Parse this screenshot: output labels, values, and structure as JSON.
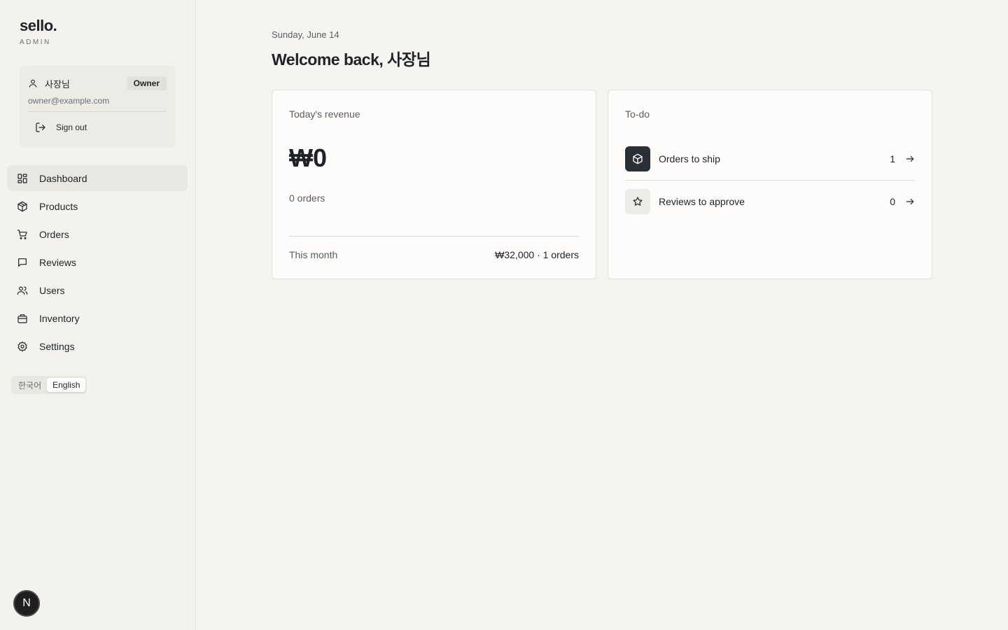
{
  "sidebar": {
    "brand": "sello.",
    "brand_sub": "ADMIN",
    "user": {
      "name": "사장님",
      "role": "Owner",
      "email": "owner@example.com",
      "signout_label": "Sign out"
    },
    "nav": [
      {
        "label": "Dashboard",
        "icon": "dashboard-icon",
        "active": true
      },
      {
        "label": "Products",
        "icon": "box-icon",
        "active": false
      },
      {
        "label": "Orders",
        "icon": "cart-icon",
        "active": false
      },
      {
        "label": "Reviews",
        "icon": "message-icon",
        "active": false
      },
      {
        "label": "Users",
        "icon": "users-icon",
        "active": false
      },
      {
        "label": "Inventory",
        "icon": "archive-icon",
        "active": false
      },
      {
        "label": "Settings",
        "icon": "gear-icon",
        "active": false
      }
    ],
    "languages": [
      {
        "label": "한국어",
        "active": false
      },
      {
        "label": "English",
        "active": true
      }
    ],
    "fab_label": "N"
  },
  "main": {
    "date": "Sunday, June 14",
    "welcome": "Welcome back, 사장님",
    "revenue": {
      "title": "Today's revenue",
      "amount": "₩0",
      "orders": "0 orders",
      "month_label": "This month",
      "month_value": "₩32,000 · 1 orders"
    },
    "todo": {
      "title": "To-do",
      "items": [
        {
          "label": "Orders to ship",
          "count": "1",
          "icon": "box-icon"
        },
        {
          "label": "Reviews to approve",
          "count": "0",
          "icon": "star-icon"
        }
      ]
    }
  },
  "colors": {
    "background": "#f5f4f0",
    "sidebar": "#f3f2ee",
    "card": "#fdfcfa",
    "text": "#1f2328",
    "muted": "#5a5e64",
    "dark_icon": "#2b2f36"
  }
}
